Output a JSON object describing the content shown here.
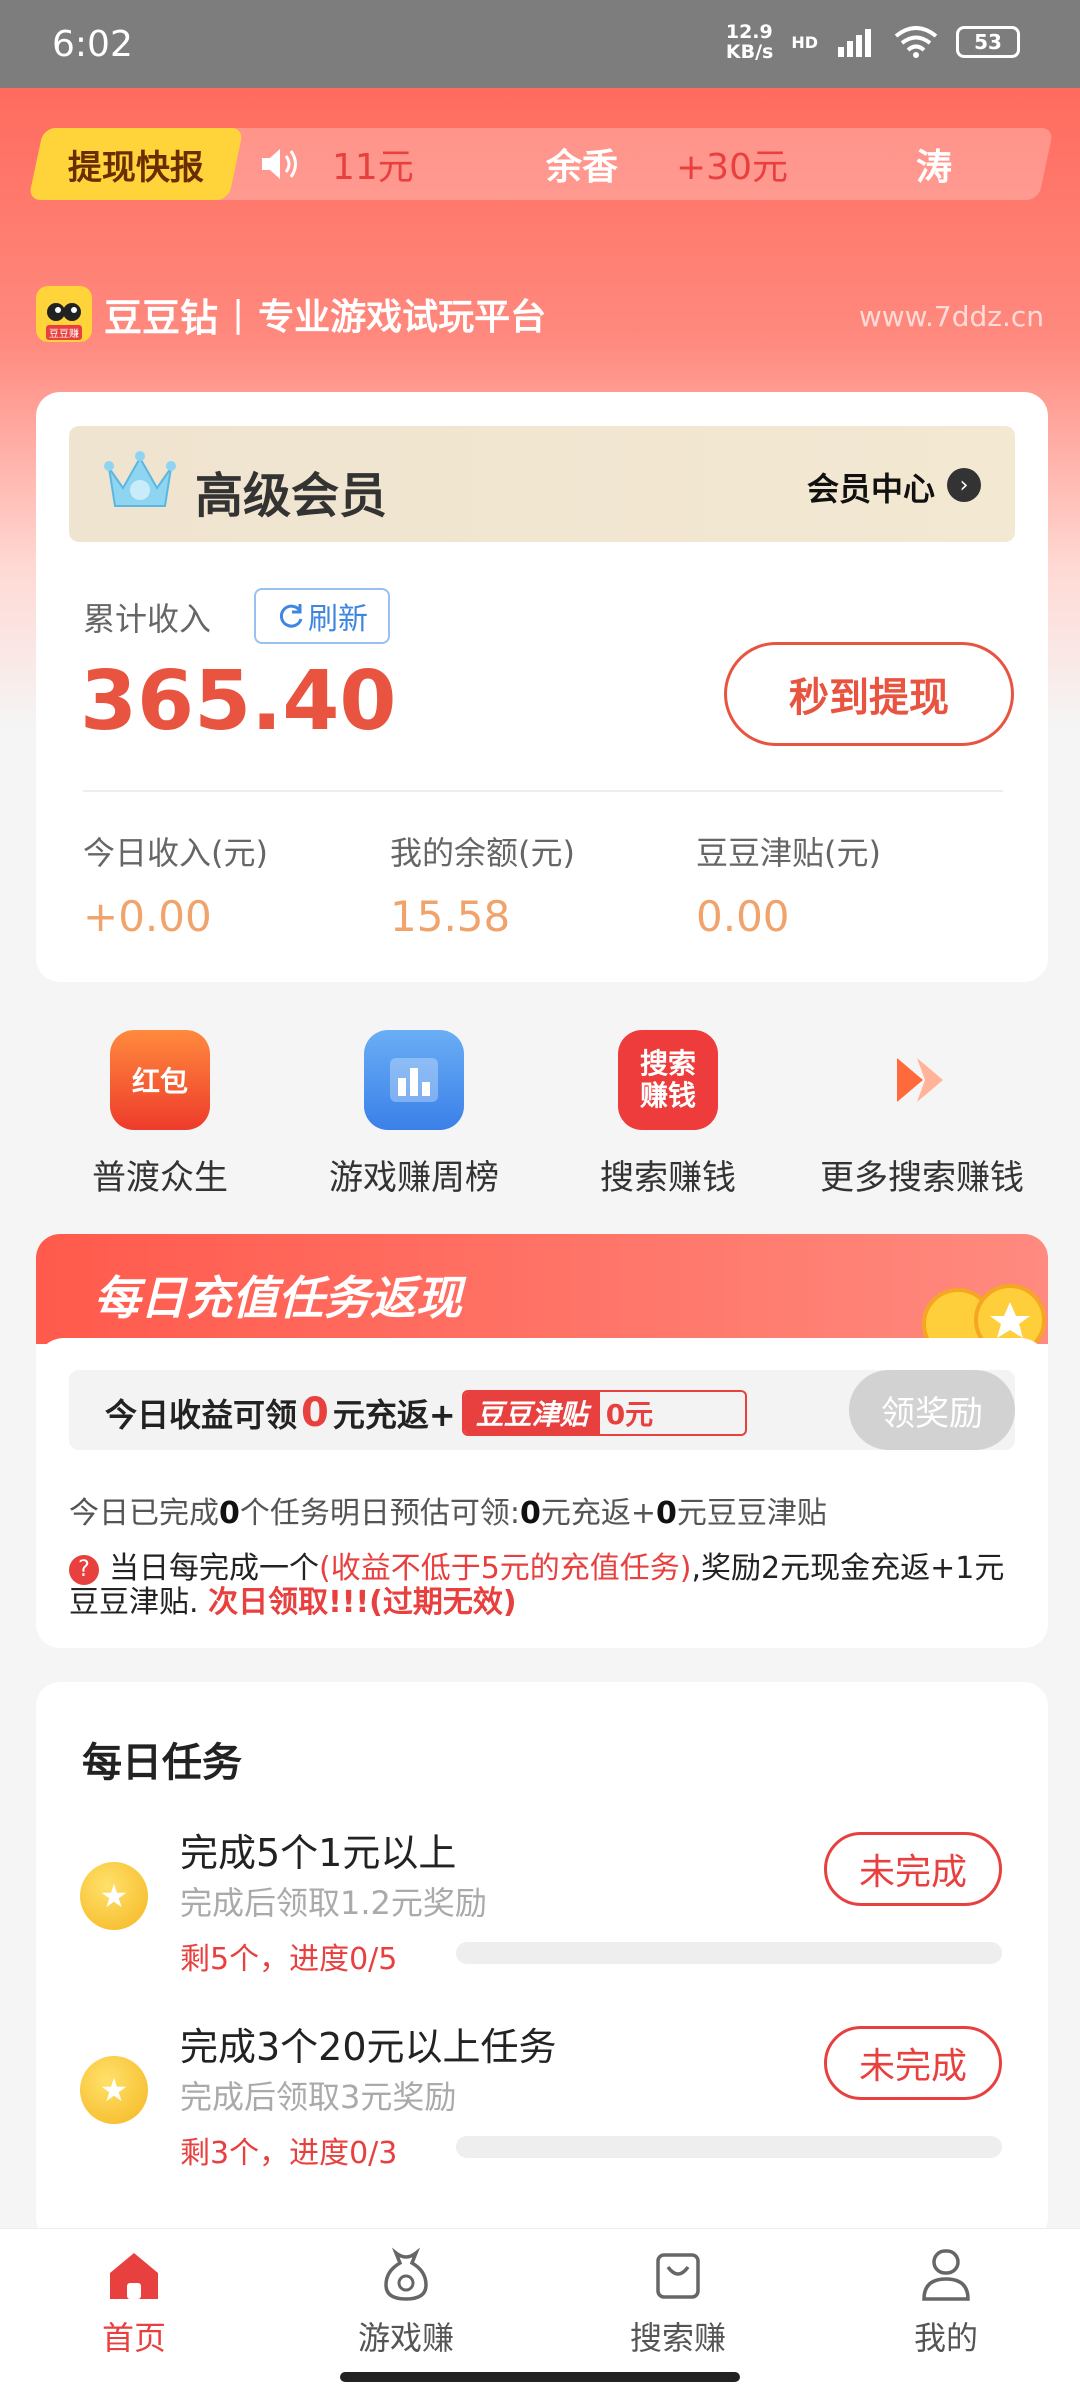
{
  "status_bar": {
    "time": "6:02",
    "network_speed_value": "12.9",
    "network_speed_unit": "KB/s",
    "network_type": "HD",
    "battery": "53"
  },
  "ticker": {
    "tag": "提现快报",
    "amount_left": "11元",
    "name": "余香",
    "amount_right": "+30元",
    "name_right": "涛"
  },
  "brand": {
    "logo_text": "豆豆赚",
    "name": "豆豆钻",
    "slogan": "专业游戏试玩平台",
    "url": "www.7ddz.cn"
  },
  "member_card": {
    "vip_title": "高级会员",
    "vip_center_label": "会员中心",
    "income_label": "累计收入",
    "refresh_label": "刷新",
    "income_value": "365.40",
    "withdraw_label": "秒到提现",
    "stats": [
      {
        "label": "今日收入(元)",
        "value": "+0.00"
      },
      {
        "label": "我的余额(元)",
        "value": "15.58"
      },
      {
        "label": "豆豆津贴(元)",
        "value": "0.00"
      }
    ]
  },
  "quick_actions": [
    {
      "label": "普渡众生",
      "icon": "red-packet-icon",
      "icon_text": "红包",
      "color": "#ff6a3d"
    },
    {
      "label": "游戏赚周榜",
      "icon": "bar-chart-icon",
      "icon_text": "",
      "color": "#4a90f0"
    },
    {
      "label": "搜索赚钱",
      "icon": "search-money-icon",
      "icon_text": "搜索赚钱",
      "color": "#ee3b3b"
    },
    {
      "label": "更多搜索赚钱",
      "icon": "double-arrow-icon",
      "icon_text": "",
      "color": "#ff6a3d"
    }
  ],
  "recharge": {
    "title": "每日充值任务返现",
    "claim_prefix": "今日收益可领",
    "claim_amount": "0",
    "claim_suffix": "元充返+",
    "subsidy_name": "豆豆津贴",
    "subsidy_value": "0元",
    "claim_button": "领奖励",
    "done_prefix": "今日已完成",
    "done_count": "0",
    "done_middle": "个任务明日预估可领:",
    "done_cash": "0",
    "done_cash_unit": "元充返+",
    "done_subsidy": "0",
    "done_subsidy_unit": "元豆豆津贴",
    "rule_prefix": "当日每完成一个",
    "rule_highlight": "(收益不低于5元的充值任务)",
    "rule_middle": ",奖励2元现金充返+1元豆豆津贴. ",
    "rule_warning": "次日领取!!!(过期无效)"
  },
  "daily_tasks": {
    "title": "每日任务",
    "items": [
      {
        "title": "完成5个1元以上",
        "subtitle": "完成后领取1.2元奖励",
        "progress_text": "剩5个，进度0/5",
        "progress": 0,
        "button": "未完成"
      },
      {
        "title": "完成3个20元以上任务",
        "subtitle": "完成后领取3元奖励",
        "progress_text": "剩3个，进度0/3",
        "progress": 0,
        "button": "未完成"
      }
    ]
  },
  "bottom_nav": [
    {
      "label": "首页",
      "icon": "home-icon",
      "active": true
    },
    {
      "label": "游戏赚",
      "icon": "money-bag-icon",
      "active": false
    },
    {
      "label": "搜索赚",
      "icon": "shopping-bag-icon",
      "active": false
    },
    {
      "label": "我的",
      "icon": "user-icon",
      "active": false
    }
  ],
  "colors": {
    "primary_red": "#e8403f",
    "hero_gradient": "#ff6b5e",
    "stat_orange": "#f0a36a"
  }
}
